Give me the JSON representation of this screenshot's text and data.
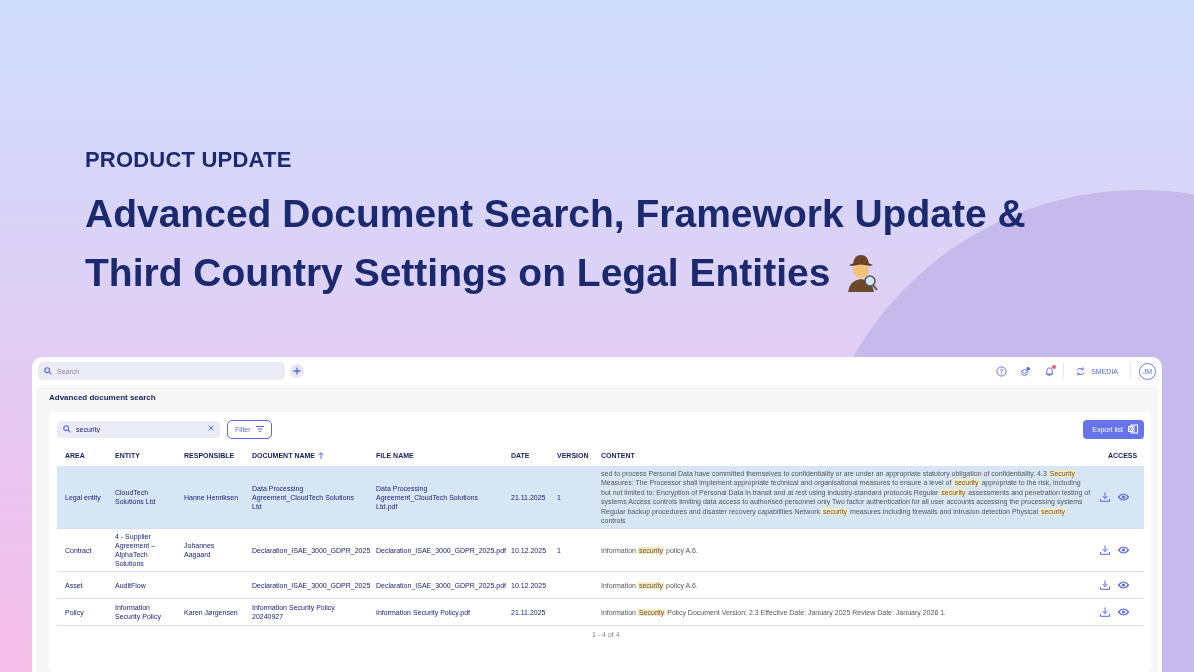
{
  "hero": {
    "eyebrow": "PRODUCT UPDATE",
    "title_lines": [
      "Advanced Document Search, Framework Update &",
      "Third Country Settings on Legal Entities"
    ]
  },
  "topbar": {
    "search_placeholder": "Search",
    "notifications_unread": true,
    "org": "SMEDIA",
    "avatar": "JM"
  },
  "page": {
    "title": "Advanced document search",
    "search": {
      "value": "security"
    },
    "filter_label": "Filter",
    "export_label": "Export list",
    "columns": [
      {
        "label": "AREA",
        "sorted": false
      },
      {
        "label": "ENTITY",
        "sorted": false
      },
      {
        "label": "RESPONSIBLE",
        "sorted": false
      },
      {
        "label": "DOCUMENT NAME",
        "sorted": true
      },
      {
        "label": "FILE NAME",
        "sorted": false
      },
      {
        "label": "DATE",
        "sorted": false
      },
      {
        "label": "VERSION",
        "sorted": false
      },
      {
        "label": "CONTENT",
        "sorted": false
      },
      {
        "label": "ACCESS",
        "sorted": false
      }
    ],
    "rows": [
      {
        "selected": true,
        "area": "Legal entity",
        "entity": "CloudTech Solutions Ltd",
        "responsible": "Hanne Henriksen",
        "document_name": "Data Processing Agreement_CloudTech Solutions Ltd",
        "file_name": "Data Processing Agreement_CloudTech Solutions Ltd.pdf",
        "date": "21.11.2025",
        "version": "1",
        "content": [
          {
            "text": "sed to process Personal Data have committed themselves to confidentiality or are under an appropriate statutory obligation of confidentiality. 4.3 ",
            "highlight": false
          },
          {
            "text": "Security",
            "highlight": true
          },
          {
            "text": " Measures: The Processor shall implement appropriate technical and organisational measures to ensure a level of ",
            "highlight": false
          },
          {
            "text": "security",
            "highlight": true
          },
          {
            "text": " appropriate to the risk, including but not limited to: Encryption of Personal Data in transit and at rest using industry-standard protocols Regular ",
            "highlight": false
          },
          {
            "text": "security",
            "highlight": true
          },
          {
            "text": " assessments and penetration testing of systems Access controls limiting data access to authorised personnel only Two factor authentication for all user accounts accessing the processing systems Regular backup procedures and disaster recovery capabilities Network ",
            "highlight": false
          },
          {
            "text": "security",
            "highlight": true
          },
          {
            "text": " measures including firewalls and intrusion detection Physical ",
            "highlight": false
          },
          {
            "text": "security",
            "highlight": true
          },
          {
            "text": " controls",
            "highlight": false
          }
        ]
      },
      {
        "selected": false,
        "area": "Contract",
        "entity": "4 - Supplier Agreement – AlphaTech Solutions",
        "responsible": "Johannes Aagaard",
        "document_name": "Declaration_ISAE_3000_GDPR_2025",
        "file_name": "Declaration_ISAE_3000_GDPR_2025.pdf",
        "date": "10.12.2025",
        "version": "1",
        "content": [
          {
            "text": "Information ",
            "highlight": false
          },
          {
            "text": "security",
            "highlight": true
          },
          {
            "text": " policy A.6.",
            "highlight": false
          }
        ]
      },
      {
        "selected": false,
        "area": "Asset",
        "entity": "AuditFlow",
        "responsible": "",
        "document_name": "Declaration_ISAE_3000_GDPR_2025",
        "file_name": "Declaration_ISAE_3000_GDPR_2025.pdf",
        "date": "10.12.2025",
        "version": "",
        "content": [
          {
            "text": "Information ",
            "highlight": false
          },
          {
            "text": "security",
            "highlight": true
          },
          {
            "text": " policy A.6.",
            "highlight": false
          }
        ]
      },
      {
        "selected": false,
        "area": "Policy",
        "entity": "Information Security Policy",
        "responsible": "Karen Jørgensen",
        "document_name": "Information Security Policy 20240927",
        "file_name": "Information Security Policy.pdf",
        "date": "21.11.2025",
        "version": "",
        "content": [
          {
            "text": "Information ",
            "highlight": false
          },
          {
            "text": "Security",
            "highlight": true
          },
          {
            "text": " Policy Document Version: 2.3 Effective Date: January 2025 Review Date: January 2026 1.",
            "highlight": false
          }
        ]
      }
    ],
    "pagination": "1 - 4 of 4"
  }
}
